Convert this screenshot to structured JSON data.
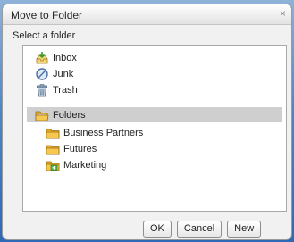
{
  "dialog": {
    "title": "Move to Folder",
    "close_symbol": "×",
    "prompt": "Select a folder"
  },
  "system_folders": [
    {
      "label": "Inbox",
      "icon": "inbox-icon"
    },
    {
      "label": "Junk",
      "icon": "junk-icon"
    },
    {
      "label": "Trash",
      "icon": "trash-icon"
    }
  ],
  "folders_root": {
    "label": "Folders",
    "icon": "folder-open-icon",
    "selected": true
  },
  "user_folders": [
    {
      "label": "Business Partners",
      "icon": "folder-icon"
    },
    {
      "label": "Futures",
      "icon": "folder-icon"
    },
    {
      "label": "Marketing",
      "icon": "folder-shared-icon"
    }
  ],
  "buttons": {
    "ok": "OK",
    "cancel": "Cancel",
    "new": "New"
  },
  "colors": {
    "selection_bg": "#cfcfcf",
    "folder_yellow": "#f2b730",
    "background_blue": "#3e77c0"
  }
}
